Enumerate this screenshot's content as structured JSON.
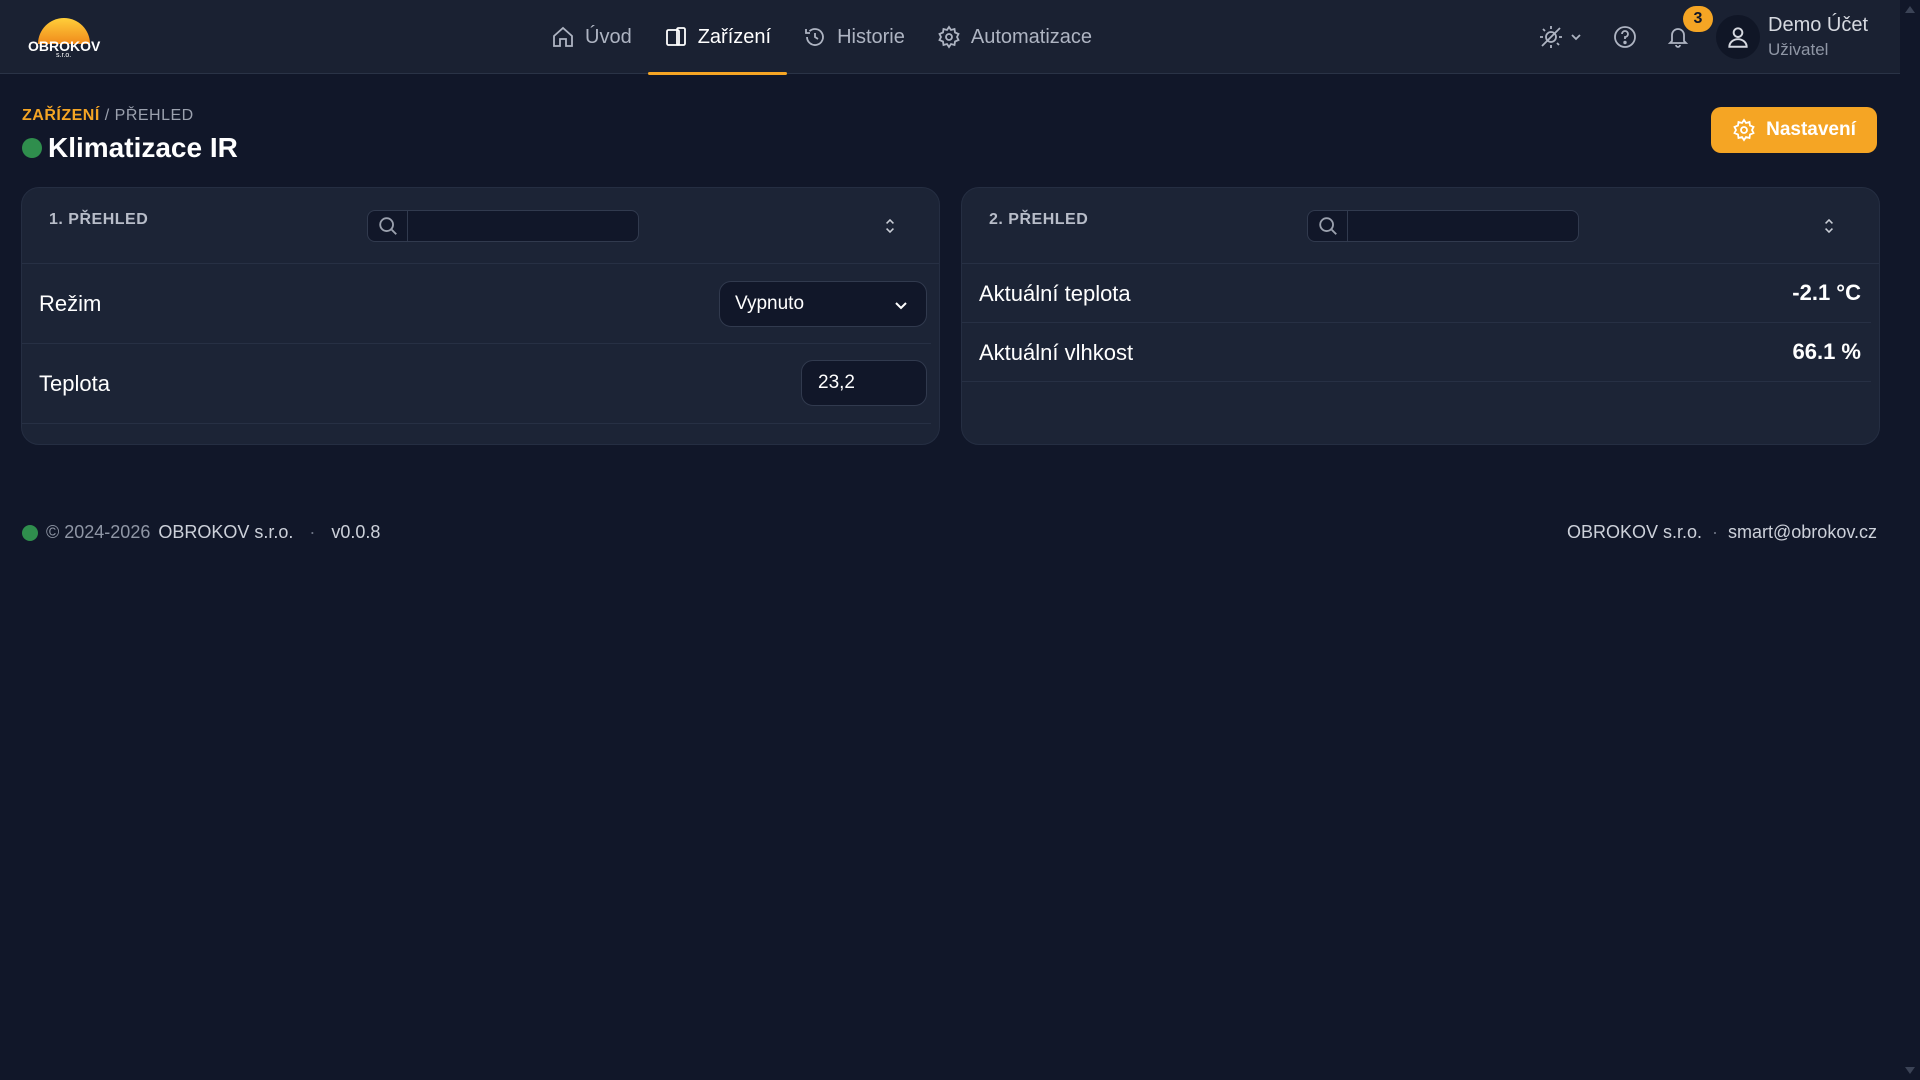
{
  "header": {
    "logo_text": "OBROKOV",
    "logo_sub": "s.r.o.",
    "nav": [
      {
        "label": "Úvod",
        "icon": "home-icon"
      },
      {
        "label": "Zařízení",
        "icon": "devices-icon",
        "active": true
      },
      {
        "label": "Historie",
        "icon": "history-icon"
      },
      {
        "label": "Automatizace",
        "icon": "gear-icon"
      }
    ],
    "notifications_count": "3",
    "user": {
      "name": "Demo Účet",
      "role": "Uživatel"
    }
  },
  "breadcrumb": {
    "current": "ZAŘÍZENÍ",
    "separator": "/",
    "last": "PŘEHLED"
  },
  "page": {
    "title": "Klimatizace IR",
    "status_color": "#2f8e4d"
  },
  "settings_button": {
    "label": "Nastavení"
  },
  "cards": [
    {
      "title": "1. PŘEHLED",
      "search_placeholder": "",
      "rows": [
        {
          "label": "Režim",
          "select_value": "Vypnuto"
        },
        {
          "label": "Teplota",
          "input_value": "23,2"
        }
      ]
    },
    {
      "title": "2. PŘEHLED",
      "search_placeholder": "",
      "rows": [
        {
          "label": "Aktuální teplota",
          "value": "-2.1 °C"
        },
        {
          "label": "Aktuální vlhkost",
          "value": "66.1 %"
        }
      ]
    }
  ],
  "footer": {
    "copyright": "© 2024-2026",
    "company": "OBROKOV s.r.o.",
    "dot": "·",
    "version": "v0.0.8",
    "right_company": "OBROKOV s.r.o.",
    "email": "smart@obrokov.cz"
  },
  "colors": {
    "accent": "#f5a524",
    "background": "#111729",
    "panel": "#1c2436",
    "online": "#2f8e4d"
  }
}
